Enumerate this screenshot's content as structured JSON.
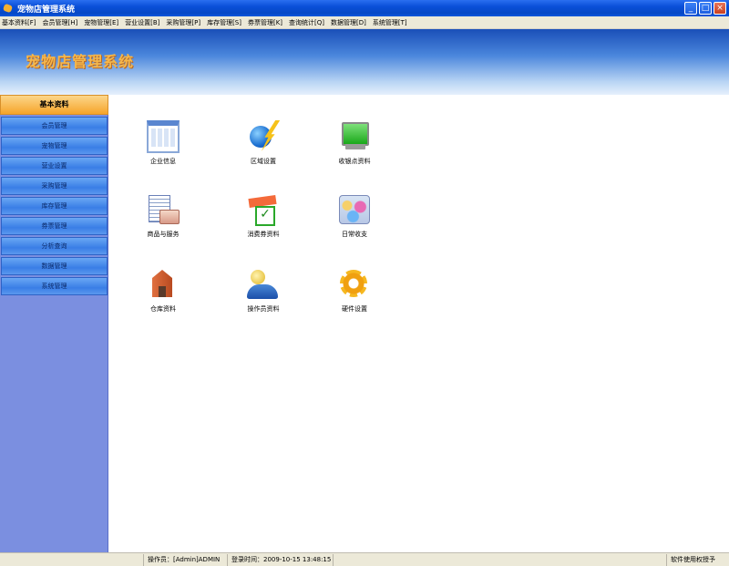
{
  "window": {
    "title": "宠物店管理系统"
  },
  "menu": [
    "基本资料[F]",
    "会员管理[H]",
    "宠物管理[E]",
    "营业设置[B]",
    "采购管理[P]",
    "库存管理[S]",
    "券票管理[K]",
    "查询统计[Q]",
    "数据管理[D]",
    "系统管理[T]"
  ],
  "banner": {
    "title": "宠物店管理系统"
  },
  "sidebar": {
    "header": "基本资料",
    "items": [
      "会员管理",
      "宠物管理",
      "营业设置",
      "采购管理",
      "库存管理",
      "券票管理",
      "分析查询",
      "数据管理",
      "系统管理"
    ]
  },
  "tiles": [
    {
      "label": "企业信息",
      "icon": "enterprise-icon"
    },
    {
      "label": "区域设置",
      "icon": "globe-lightning-icon"
    },
    {
      "label": "收银点资料",
      "icon": "monitor-icon"
    },
    {
      "label": "商品与服务",
      "icon": "goods-document-icon"
    },
    {
      "label": "消费券资料",
      "icon": "voucher-check-icon"
    },
    {
      "label": "日常收支",
      "icon": "daily-balance-icon"
    },
    {
      "label": "仓库资料",
      "icon": "warehouse-icon"
    },
    {
      "label": "操作员资料",
      "icon": "operator-user-icon"
    },
    {
      "label": "硬件设置",
      "icon": "hardware-gear-icon"
    }
  ],
  "status": {
    "operator": "操作员：[Admin]ADMIN",
    "login_time": "登录时间：2009-10-15 13:48:15",
    "license": "软件使用权授予"
  }
}
